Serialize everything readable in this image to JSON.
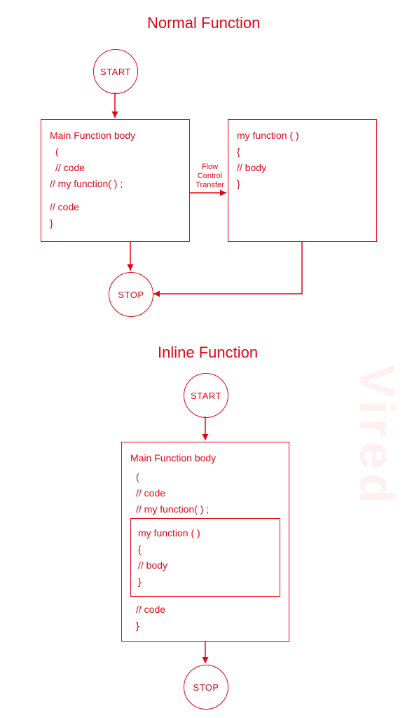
{
  "diagram": {
    "type": "flowchart-comparison",
    "sections": {
      "normal": {
        "title": "Normal Function",
        "start": "START",
        "stop": "STOP",
        "main_box": {
          "heading": "Main  Function  body",
          "l1": "(",
          "l2": "// code",
          "l3": "// my function( ) ;",
          "l4": "// code",
          "l5": "}"
        },
        "callee_box": {
          "l1": "my function ( )",
          "l2": "{",
          "l3": "//  body",
          "l4": "}"
        },
        "flow_label": {
          "l1": "Flow",
          "l2": "Control",
          "l3": "Transfer"
        }
      },
      "inline": {
        "title": "Inline Function",
        "start": "START",
        "stop": "STOP",
        "main_box": {
          "heading": "Main  Function  body",
          "l1": "(",
          "l2": "// code",
          "l3": "// my function( ) ;",
          "inlined": {
            "l1": "my function ( )",
            "l2": "{",
            "l3": "// body",
            "l4": "}"
          },
          "l4": "// code",
          "l5": "}"
        }
      }
    },
    "watermark": "Vired",
    "colors": {
      "accent": "#e30613",
      "background": "#ffffff"
    }
  }
}
